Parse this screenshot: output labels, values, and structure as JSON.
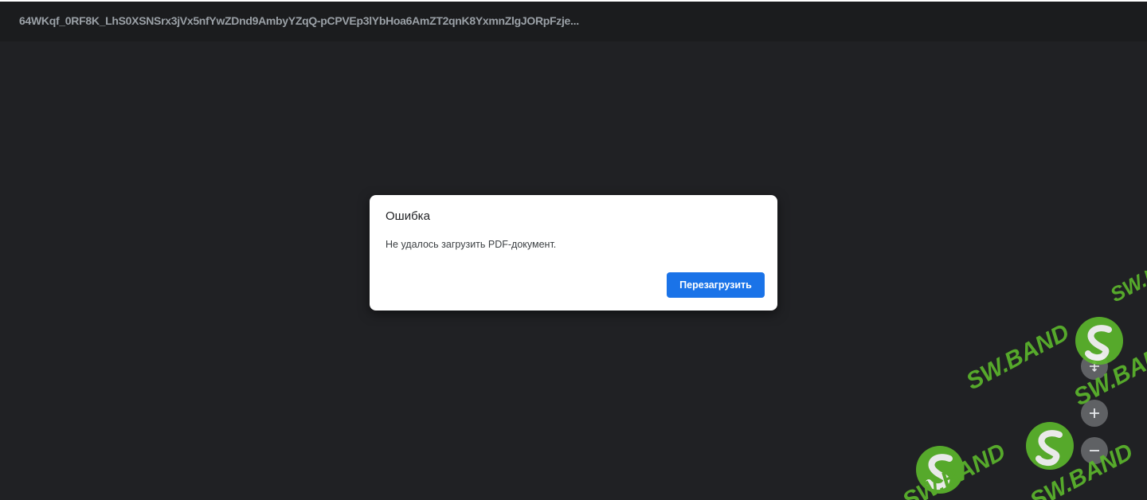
{
  "toolbar": {
    "document_title": "64WKqf_0RF8K_LhS0XSNSrx3jVx5nfYwZDnd9AmbyYZqQ-pCPVEp3lYbHoa6AmZT2qnK8YxmnZlgJORpFzje..."
  },
  "dialog": {
    "title": "Ошибка",
    "message": "Не удалось загрузить PDF-документ.",
    "reload_label": "Перезагрузить"
  },
  "zoom_controls": {
    "fit_icon": "fit-page-icon",
    "zoom_in_icon": "zoom-in-icon",
    "zoom_out_icon": "zoom-out-icon"
  },
  "watermark": {
    "text": "SW.BAND"
  },
  "colors": {
    "viewer_bg": "#202124",
    "toolbar_bg": "#1b1c1e",
    "accent": "#1a73e8",
    "watermark_green": "#5cb82c"
  }
}
